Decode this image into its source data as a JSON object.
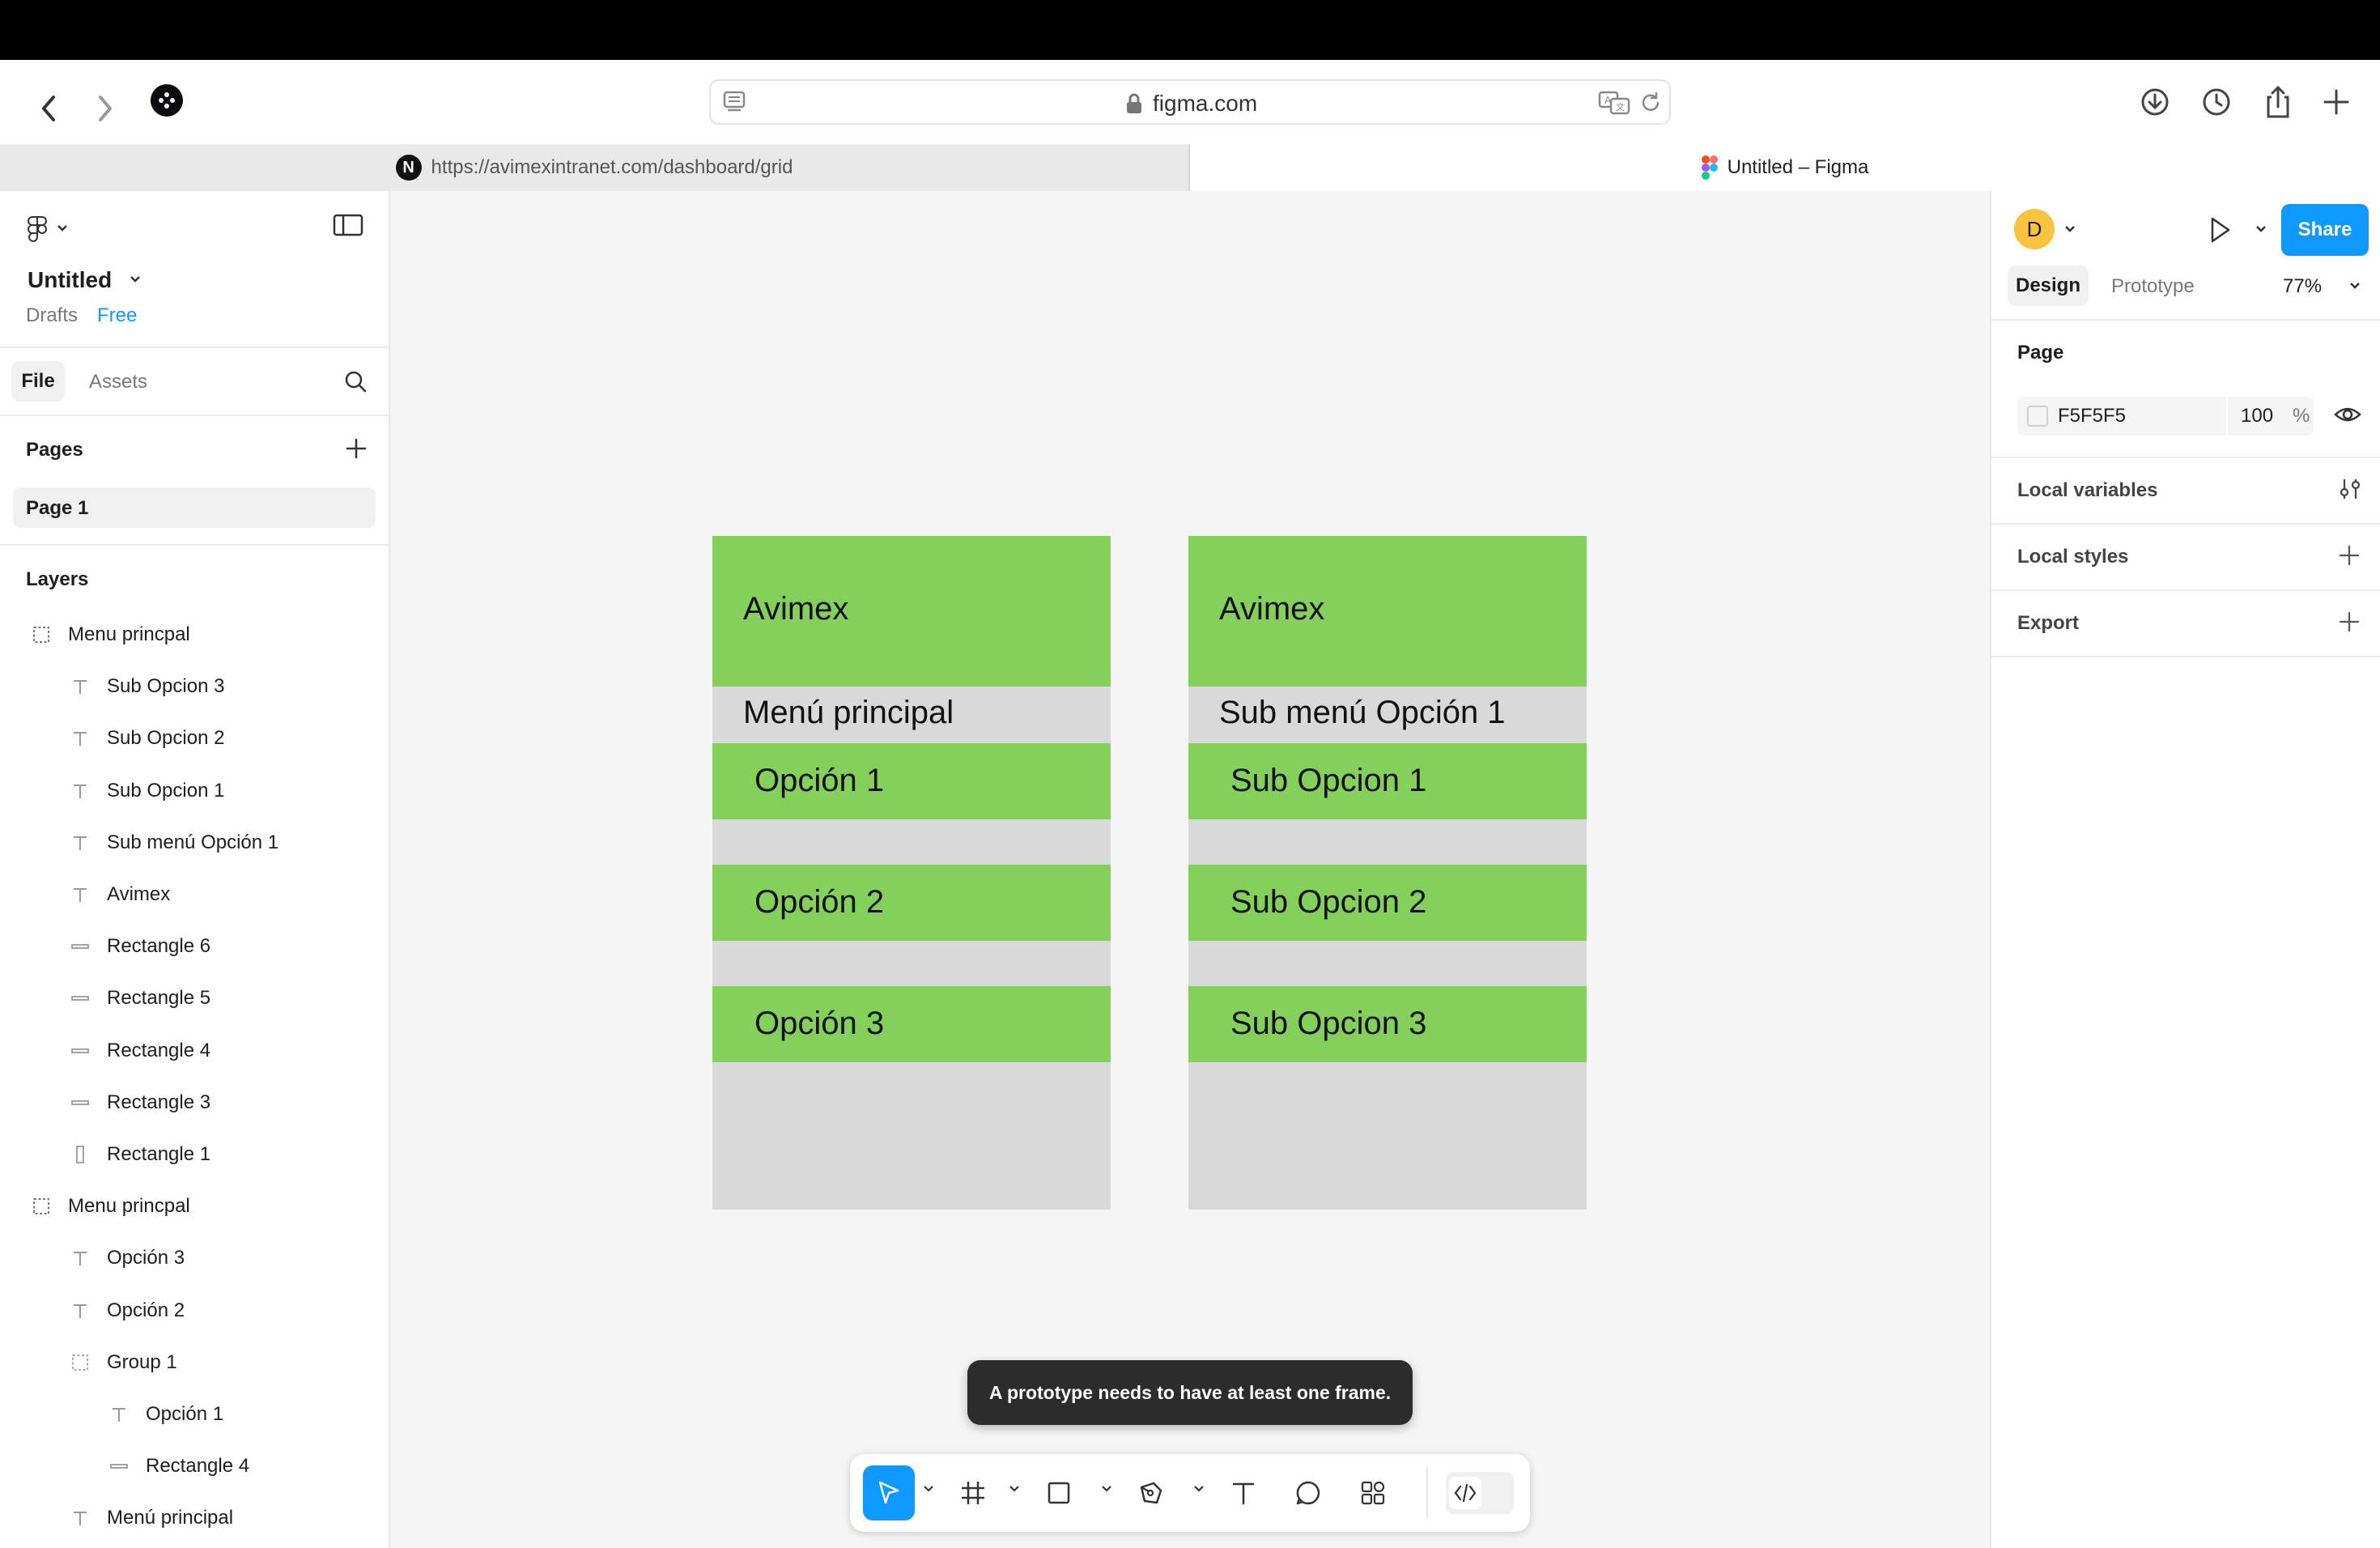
{
  "browser": {
    "address": "figma.com",
    "tabs": [
      {
        "favicon": "N",
        "label": "https://avimexintranet.com/dashboard/grid"
      },
      {
        "label": "Untitled – Figma"
      }
    ]
  },
  "file": {
    "title": "Untitled",
    "location": "Drafts",
    "plan": "Free"
  },
  "left_panel": {
    "tabs": {
      "file": "File",
      "assets": "Assets"
    },
    "pages_heading": "Pages",
    "pages": [
      "Page 1"
    ],
    "layers_heading": "Layers",
    "layers": [
      {
        "name": "Menu princpal",
        "type": "frame-icon",
        "depth": 0
      },
      {
        "name": "Sub Opcion 3",
        "type": "text-icon",
        "depth": 1
      },
      {
        "name": "Sub Opcion 2",
        "type": "text-icon",
        "depth": 1
      },
      {
        "name": "Sub Opcion 1",
        "type": "text-icon",
        "depth": 1
      },
      {
        "name": "Sub menú Opción 1",
        "type": "text-icon",
        "depth": 1
      },
      {
        "name": "Avimex",
        "type": "text-icon",
        "depth": 1
      },
      {
        "name": "Rectangle 6",
        "type": "rect-h-icon",
        "depth": 1
      },
      {
        "name": "Rectangle 5",
        "type": "rect-h-icon",
        "depth": 1
      },
      {
        "name": "Rectangle 4",
        "type": "rect-h-icon",
        "depth": 1
      },
      {
        "name": "Rectangle 3",
        "type": "rect-h-icon",
        "depth": 1
      },
      {
        "name": "Rectangle 1",
        "type": "rect-v-icon",
        "depth": 1
      },
      {
        "name": "Menu princpal",
        "type": "frame-icon",
        "depth": 0
      },
      {
        "name": "Opción 3",
        "type": "text-icon",
        "depth": 1
      },
      {
        "name": "Opción 2",
        "type": "text-icon",
        "depth": 1
      },
      {
        "name": "Group 1",
        "type": "group-icon",
        "depth": 1
      },
      {
        "name": "Opción 1",
        "type": "text-icon",
        "depth": 2
      },
      {
        "name": "Rectangle 4",
        "type": "rect-h-icon",
        "depth": 2
      },
      {
        "name": "Menú principal",
        "type": "text-icon",
        "depth": 1
      }
    ]
  },
  "canvas": {
    "frames": [
      {
        "brand": "Avimex",
        "subtitle": "Menú principal",
        "options": [
          "Opción 1",
          "Opción 2",
          "Opción 3"
        ]
      },
      {
        "brand": "Avimex",
        "subtitle": "Sub menú Opción 1",
        "options": [
          "Sub Opcion 1",
          "Sub Opcion 2",
          "Sub Opcion 3"
        ]
      }
    ],
    "toast": "A prototype needs to have at least one frame.",
    "help": "?"
  },
  "right_panel": {
    "avatar_initial": "D",
    "share": "Share",
    "tabs": {
      "design": "Design",
      "prototype": "Prototype"
    },
    "zoom": "77%",
    "page_heading": "Page",
    "page_color": "F5F5F5",
    "page_opacity": "100",
    "percent": "%",
    "sections": [
      "Local variables",
      "Local styles",
      "Export"
    ]
  },
  "colors": {
    "accent": "#0d99ff",
    "frame_green": "#83d15a",
    "frame_gray": "#d9d9d9",
    "canvas_bg": "#f5f5f5"
  }
}
